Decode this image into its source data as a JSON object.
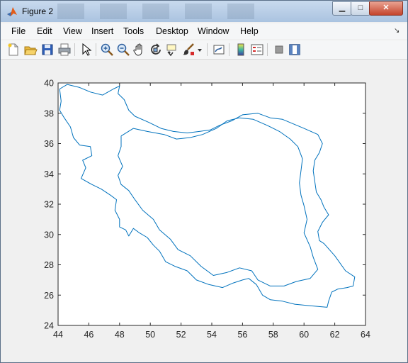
{
  "window": {
    "title": "Figure 2"
  },
  "menu": [
    "File",
    "Edit",
    "View",
    "Insert",
    "Tools",
    "Desktop",
    "Window",
    "Help"
  ],
  "toolbar_icons": [
    "new-figure-icon",
    "open-file-icon",
    "save-icon",
    "print-icon",
    "pointer-icon",
    "zoom-in-icon",
    "zoom-out-icon",
    "pan-hand-icon",
    "rotate-3d-icon",
    "data-cursor-icon",
    "brush-icon",
    "brush-dropdown-icon",
    "link-plot-icon",
    "colorbar-icon",
    "legend-icon",
    "hide-plot-tools-icon",
    "show-plot-tools-icon"
  ],
  "chart_data": {
    "type": "line",
    "title": "",
    "xlabel": "",
    "ylabel": "",
    "xlim": [
      44,
      64
    ],
    "ylim": [
      24,
      40
    ],
    "xticks": [
      44,
      46,
      48,
      50,
      52,
      54,
      56,
      58,
      60,
      62,
      64
    ],
    "yticks": [
      24,
      26,
      28,
      30,
      32,
      34,
      36,
      38,
      40
    ],
    "grid": false,
    "line_color": "#0072bd",
    "series": [
      {
        "points": [
          [
            44.1,
            39.6
          ],
          [
            44.6,
            39.9
          ],
          [
            45.4,
            39.7
          ],
          [
            46.1,
            39.4
          ],
          [
            46.9,
            39.2
          ],
          [
            47.6,
            39.6
          ],
          [
            48.0,
            39.8
          ],
          [
            47.9,
            39.3
          ],
          [
            48.3,
            38.9
          ],
          [
            48.6,
            38.2
          ],
          [
            49.0,
            37.8
          ],
          [
            49.9,
            37.4
          ],
          [
            50.7,
            37.0
          ],
          [
            51.5,
            36.8
          ],
          [
            52.4,
            36.7
          ],
          [
            53.2,
            36.8
          ],
          [
            53.9,
            36.9
          ],
          [
            54.5,
            37.2
          ],
          [
            55.3,
            37.5
          ],
          [
            56.0,
            37.9
          ],
          [
            57.0,
            38.0
          ],
          [
            57.8,
            37.7
          ],
          [
            58.6,
            37.6
          ],
          [
            59.3,
            37.3
          ],
          [
            60.0,
            37.0
          ],
          [
            60.9,
            36.6
          ],
          [
            61.2,
            36.0
          ],
          [
            61.0,
            35.4
          ],
          [
            60.7,
            34.9
          ],
          [
            60.6,
            34.2
          ],
          [
            60.7,
            33.5
          ],
          [
            60.8,
            32.8
          ],
          [
            61.1,
            32.3
          ],
          [
            61.3,
            31.8
          ],
          [
            61.6,
            31.3
          ],
          [
            61.2,
            30.8
          ],
          [
            60.9,
            30.2
          ],
          [
            61.0,
            29.6
          ],
          [
            61.3,
            29.4
          ],
          [
            62.0,
            28.6
          ],
          [
            62.7,
            27.6
          ],
          [
            63.3,
            27.2
          ],
          [
            63.2,
            26.6
          ],
          [
            62.8,
            26.5
          ],
          [
            62.2,
            26.4
          ],
          [
            61.8,
            26.2
          ],
          [
            61.6,
            25.6
          ],
          [
            61.5,
            25.2
          ],
          [
            60.4,
            25.3
          ],
          [
            59.4,
            25.4
          ],
          [
            58.6,
            25.6
          ],
          [
            57.8,
            25.7
          ],
          [
            57.3,
            26.0
          ],
          [
            56.9,
            26.7
          ],
          [
            56.4,
            27.1
          ],
          [
            56.0,
            27.0
          ],
          [
            55.4,
            26.8
          ],
          [
            54.7,
            26.5
          ],
          [
            53.8,
            26.7
          ],
          [
            53.0,
            27.0
          ],
          [
            52.4,
            27.6
          ],
          [
            51.6,
            27.9
          ],
          [
            51.0,
            28.2
          ],
          [
            50.6,
            28.9
          ],
          [
            50.2,
            29.3
          ],
          [
            49.8,
            29.8
          ],
          [
            49.3,
            30.1
          ],
          [
            48.9,
            30.4
          ],
          [
            48.6,
            29.9
          ],
          [
            48.4,
            30.3
          ],
          [
            48.0,
            30.5
          ],
          [
            48.0,
            31.0
          ],
          [
            47.7,
            31.6
          ],
          [
            47.8,
            32.3
          ],
          [
            47.4,
            32.6
          ],
          [
            46.8,
            33.0
          ],
          [
            46.2,
            33.3
          ],
          [
            45.5,
            33.7
          ],
          [
            45.8,
            34.4
          ],
          [
            45.6,
            34.9
          ],
          [
            46.2,
            35.2
          ],
          [
            46.1,
            35.8
          ],
          [
            45.4,
            35.9
          ],
          [
            45.0,
            36.4
          ],
          [
            44.8,
            37.1
          ],
          [
            44.4,
            37.7
          ],
          [
            44.1,
            38.2
          ],
          [
            44.2,
            38.8
          ],
          [
            44.1,
            39.6
          ]
        ]
      },
      {
        "points": [
          [
            48.1,
            36.5
          ],
          [
            48.9,
            37.0
          ],
          [
            49.8,
            36.8
          ],
          [
            50.9,
            36.6
          ],
          [
            51.7,
            36.3
          ],
          [
            52.6,
            36.4
          ],
          [
            53.4,
            36.6
          ],
          [
            54.3,
            37.0
          ],
          [
            55.0,
            37.5
          ],
          [
            55.8,
            37.7
          ],
          [
            56.7,
            37.6
          ],
          [
            57.6,
            37.2
          ],
          [
            58.4,
            36.8
          ],
          [
            59.1,
            36.3
          ],
          [
            59.6,
            35.8
          ],
          [
            59.9,
            35.0
          ],
          [
            59.8,
            34.2
          ],
          [
            59.7,
            33.4
          ],
          [
            59.8,
            32.6
          ],
          [
            60.0,
            31.9
          ],
          [
            60.2,
            31.0
          ],
          [
            60.0,
            30.1
          ],
          [
            60.4,
            29.2
          ],
          [
            60.6,
            28.5
          ],
          [
            60.9,
            27.7
          ],
          [
            60.4,
            27.1
          ],
          [
            59.5,
            26.9
          ],
          [
            58.7,
            26.6
          ],
          [
            57.8,
            26.6
          ],
          [
            57.0,
            27.0
          ],
          [
            56.6,
            27.6
          ],
          [
            55.8,
            27.8
          ],
          [
            55.0,
            27.5
          ],
          [
            54.1,
            27.3
          ],
          [
            53.3,
            27.9
          ],
          [
            52.6,
            28.6
          ],
          [
            51.8,
            29.0
          ],
          [
            51.3,
            29.7
          ],
          [
            50.6,
            30.3
          ],
          [
            50.2,
            31.0
          ],
          [
            49.5,
            31.6
          ],
          [
            49.0,
            32.3
          ],
          [
            48.6,
            32.9
          ],
          [
            48.1,
            33.3
          ],
          [
            47.9,
            33.9
          ],
          [
            48.2,
            34.5
          ],
          [
            47.9,
            35.2
          ],
          [
            48.1,
            35.8
          ],
          [
            48.1,
            36.5
          ]
        ]
      }
    ]
  }
}
